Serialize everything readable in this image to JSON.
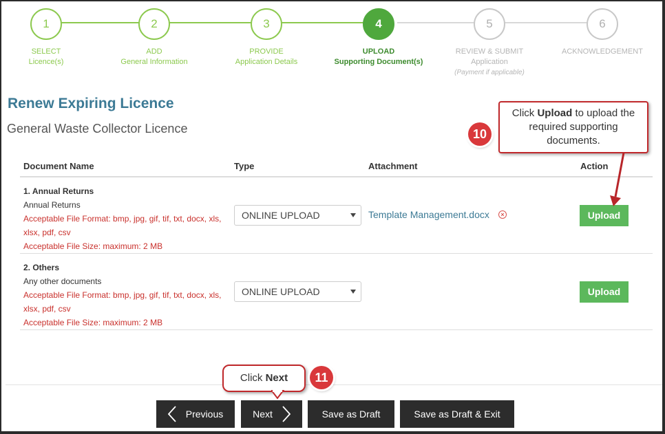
{
  "stepper": {
    "steps": [
      {
        "number": "1",
        "title": "SELECT",
        "sub": "Licence(s)",
        "note": ""
      },
      {
        "number": "2",
        "title": "ADD",
        "sub": "General Information",
        "note": ""
      },
      {
        "number": "3",
        "title": "PROVIDE",
        "sub": "Application Details",
        "note": ""
      },
      {
        "number": "4",
        "title": "UPLOAD",
        "sub": "Supporting Document(s)",
        "note": ""
      },
      {
        "number": "5",
        "title": "REVIEW & SUBMIT",
        "sub": "Application",
        "note": "(Payment if applicable)"
      },
      {
        "number": "6",
        "title": "ACKNOWLEDGEMENT",
        "sub": "",
        "note": ""
      }
    ],
    "colors": {
      "done": "#8cc94e",
      "active": "#4fa83d",
      "future": "#c8c8c8"
    }
  },
  "page": {
    "title": "Renew Expiring Licence",
    "subtitle": "General Waste Collector Licence"
  },
  "table": {
    "headers": {
      "name": "Document Name",
      "type": "Type",
      "attachment": "Attachment",
      "action": "Action"
    },
    "rows": [
      {
        "title": "1. Annual Returns",
        "description": "Annual Returns",
        "format_line1": "Acceptable File Format: bmp, jpg, gif, tif, txt, docx, xls,",
        "format_line2": "xlsx, pdf, csv",
        "size": "Acceptable File Size: maximum: 2 MB",
        "type_value": "ONLINE UPLOAD",
        "attachment": "Template Management.docx",
        "action_label": "Upload"
      },
      {
        "title": "2. Others",
        "description": "Any other documents",
        "format_line1": "Acceptable File Format: bmp, jpg, gif, tif, txt, docx, xls,",
        "format_line2": "xlsx, pdf, csv",
        "size": "Acceptable File Size: maximum: 2 MB",
        "type_value": "ONLINE UPLOAD",
        "attachment": "",
        "action_label": "Upload"
      }
    ]
  },
  "footer": {
    "previous": "Previous",
    "next": "Next",
    "save_draft": "Save as Draft",
    "save_draft_exit": "Save as Draft & Exit"
  },
  "callouts": {
    "upload": {
      "number": "10",
      "pre": "Click ",
      "bold": "Upload",
      "post": " to upload the required supporting documents."
    },
    "next": {
      "number": "11",
      "pre": "Click ",
      "bold": "Next"
    }
  },
  "icons": {
    "remove": "close-circle-icon",
    "previous": "chevron-left-icon",
    "next": "chevron-right-icon",
    "select": "caret-down-icon"
  }
}
